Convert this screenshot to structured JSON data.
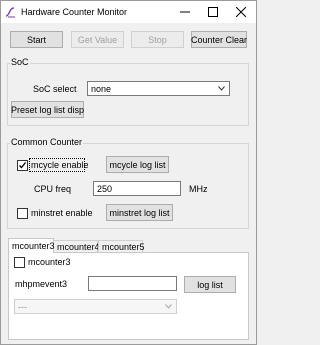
{
  "window": {
    "title": "Hardware Counter Monitor"
  },
  "toolbar": {
    "start": "Start",
    "get_value": "Get Value",
    "stop": "Stop",
    "counter_clear": "Counter Clear"
  },
  "soc": {
    "group_label": "SoC",
    "select_label": "SoC select",
    "select_value": "none",
    "preset_button": "Preset log list disp"
  },
  "common": {
    "group_label": "Common Counter",
    "mcycle_enable": "mcycle enable",
    "mcycle_enable_checked": true,
    "mcycle_log_button": "mcycle log list",
    "cpu_freq_label": "CPU freq",
    "cpu_freq_value": "250",
    "cpu_freq_unit": "MHz",
    "minstret_enable": "minstret enable",
    "minstret_enable_checked": false,
    "minstret_log_button": "minstret log list"
  },
  "tabs": [
    {
      "label": "mcounter3"
    },
    {
      "label": "mcounter4"
    },
    {
      "label": "mcounter5"
    }
  ],
  "panel": {
    "enable_label": "mcounter3",
    "event_label": "mhpmevent3",
    "event_value": "",
    "log_button": "log list",
    "event_select_value": "---"
  }
}
